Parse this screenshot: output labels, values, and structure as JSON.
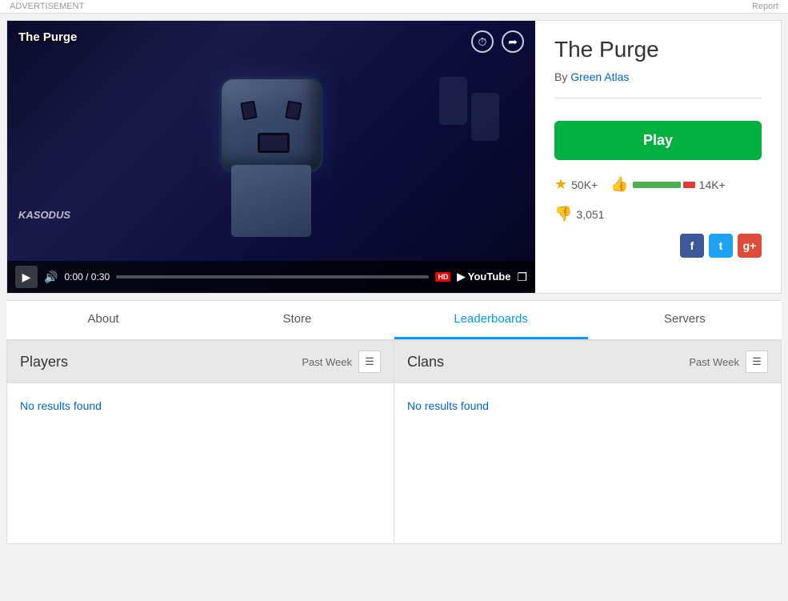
{
  "topbar": {
    "advertisement": "ADVERTISEMENT",
    "report": "Report"
  },
  "game": {
    "title": "The Purge",
    "author_label": "By",
    "author_name": "Green Atlas",
    "play_button": "Play",
    "favorites": "50K+",
    "likes": "14K+",
    "dislikes": "3,051",
    "video_title": "The Purge",
    "watermark": "KASODUS",
    "time_current": "0:00",
    "time_total": "0:30",
    "time_display": "0:00 / 0:30"
  },
  "tabs": [
    {
      "label": "About",
      "active": false
    },
    {
      "label": "Store",
      "active": false
    },
    {
      "label": "Leaderboards",
      "active": true
    },
    {
      "label": "Servers",
      "active": false
    }
  ],
  "leaderboards": {
    "players_title": "Players",
    "players_period": "Past Week",
    "players_no_results": "No results found",
    "clans_title": "Clans",
    "clans_period": "Past Week",
    "clans_no_results": "No results found"
  },
  "social": {
    "facebook": "f",
    "twitter": "t",
    "googleplus": "g+"
  }
}
